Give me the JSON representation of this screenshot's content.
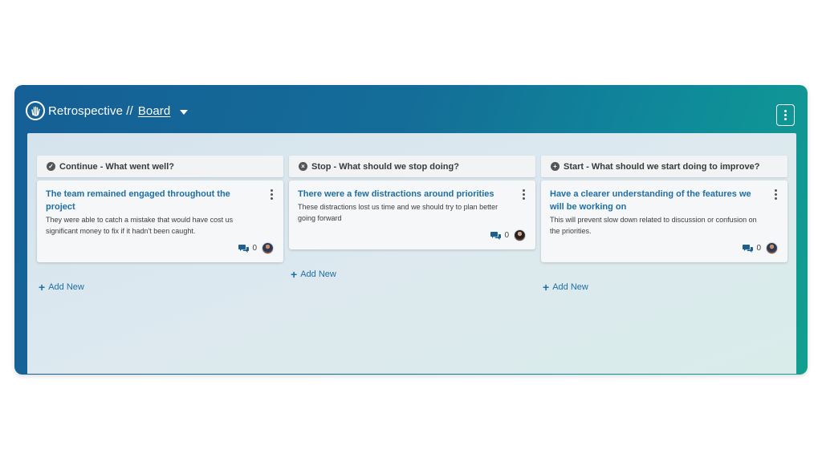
{
  "header": {
    "app_name": "Retrospective //",
    "board_label": "Board",
    "logo_icon": "hand-icon",
    "menu_icon": "kebab-icon"
  },
  "columns": [
    {
      "title": "Continue - What went well?",
      "icon": "check-circle-icon",
      "card": {
        "title": "The team remained engaged throughout the project",
        "body": "They were able to catch a mistake that would have cost us significant money to fix if it hadn't been caught.",
        "comment_count": "0"
      },
      "add_label": "Add New"
    },
    {
      "title": "Stop - What should we stop doing?",
      "icon": "x-circle-icon",
      "card": {
        "title": "There were a few distractions around priorities",
        "body": "These distractions lost us time and we should try to plan better going forward",
        "comment_count": "0"
      },
      "add_label": "Add New"
    },
    {
      "title": "Start - What should we start doing to improve?",
      "icon": "plus-circle-icon",
      "card": {
        "title": "Have a clearer understanding of the features we will be working on",
        "body": "This will prevent slow down related to discussion or confusion on the priorities.",
        "comment_count": "0"
      },
      "add_label": "Add New"
    }
  ],
  "colors": {
    "header_gradient_start": "#155f96",
    "header_gradient_end": "#10a08f",
    "card_title": "#1d6fa5",
    "board_bg": "#d5e3ee"
  }
}
